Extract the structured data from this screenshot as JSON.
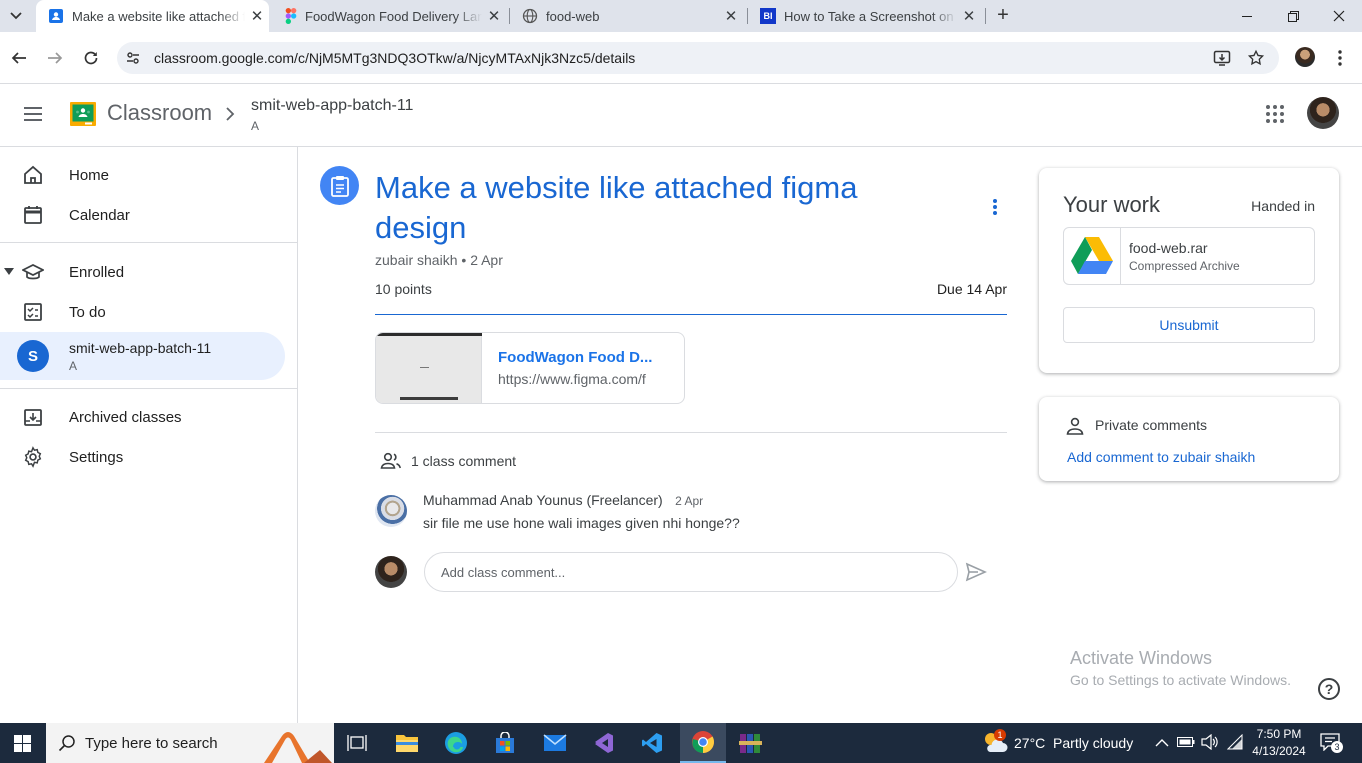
{
  "browser": {
    "tabs": [
      {
        "title": "Make a website like attached figma design",
        "active": true
      },
      {
        "title": "FoodWagon Food Delivery Landing Page",
        "active": false
      },
      {
        "title": "food-web",
        "active": false
      },
      {
        "title": "How to Take a Screenshot on Windows",
        "active": false
      }
    ],
    "new_tab": "+",
    "url": "classroom.google.com/c/NjM5MTg3NDQ3OTkw/a/NjcyMTAxNjk3Nzc5/details"
  },
  "header": {
    "app_name": "Classroom",
    "class_name": "smit-web-app-batch-11",
    "section": "A"
  },
  "sidebar": {
    "items": [
      {
        "label": "Home"
      },
      {
        "label": "Calendar"
      },
      {
        "label": "Enrolled"
      },
      {
        "label": "To do"
      },
      {
        "label": "smit-web-app-batch-11",
        "sub": "A",
        "initial": "S"
      },
      {
        "label": "Archived classes"
      },
      {
        "label": "Settings"
      }
    ]
  },
  "assignment": {
    "title": "Make a website like attached figma design",
    "author": "zubair shaikh",
    "date": "2 Apr",
    "points": "10 points",
    "due": "Due 14 Apr",
    "attachment": {
      "title": "FoodWagon Food D...",
      "url": "https://www.figma.com/f"
    }
  },
  "comments": {
    "count_label": "1 class comment",
    "items": [
      {
        "author": "Muhammad Anab Younus (Freelancer)",
        "date": "2 Apr",
        "text": "sir file me use hone wali images given nhi honge??"
      }
    ],
    "input_placeholder": "Add class comment..."
  },
  "your_work": {
    "title": "Your work",
    "status": "Handed in",
    "file_name": "food-web.rar",
    "file_type": "Compressed Archive",
    "unsubmit": "Unsubmit"
  },
  "private_comments": {
    "title": "Private comments",
    "add_link": "Add comment to zubair shaikh"
  },
  "watermark": {
    "line1": "Activate Windows",
    "line2": "Go to Settings to activate Windows."
  },
  "taskbar": {
    "search_placeholder": "Type here to search",
    "weather": "27°C  Partly cloudy",
    "weather_badge": "1",
    "time": "7:50 PM",
    "date": "4/13/2024",
    "notif_count": "3"
  },
  "colors": {
    "accent": "#1967d2",
    "chrome_tabstrip": "#dfe3eb",
    "sidebar_selected": "#e8f0fe",
    "taskbar": "#1c2a3d"
  }
}
